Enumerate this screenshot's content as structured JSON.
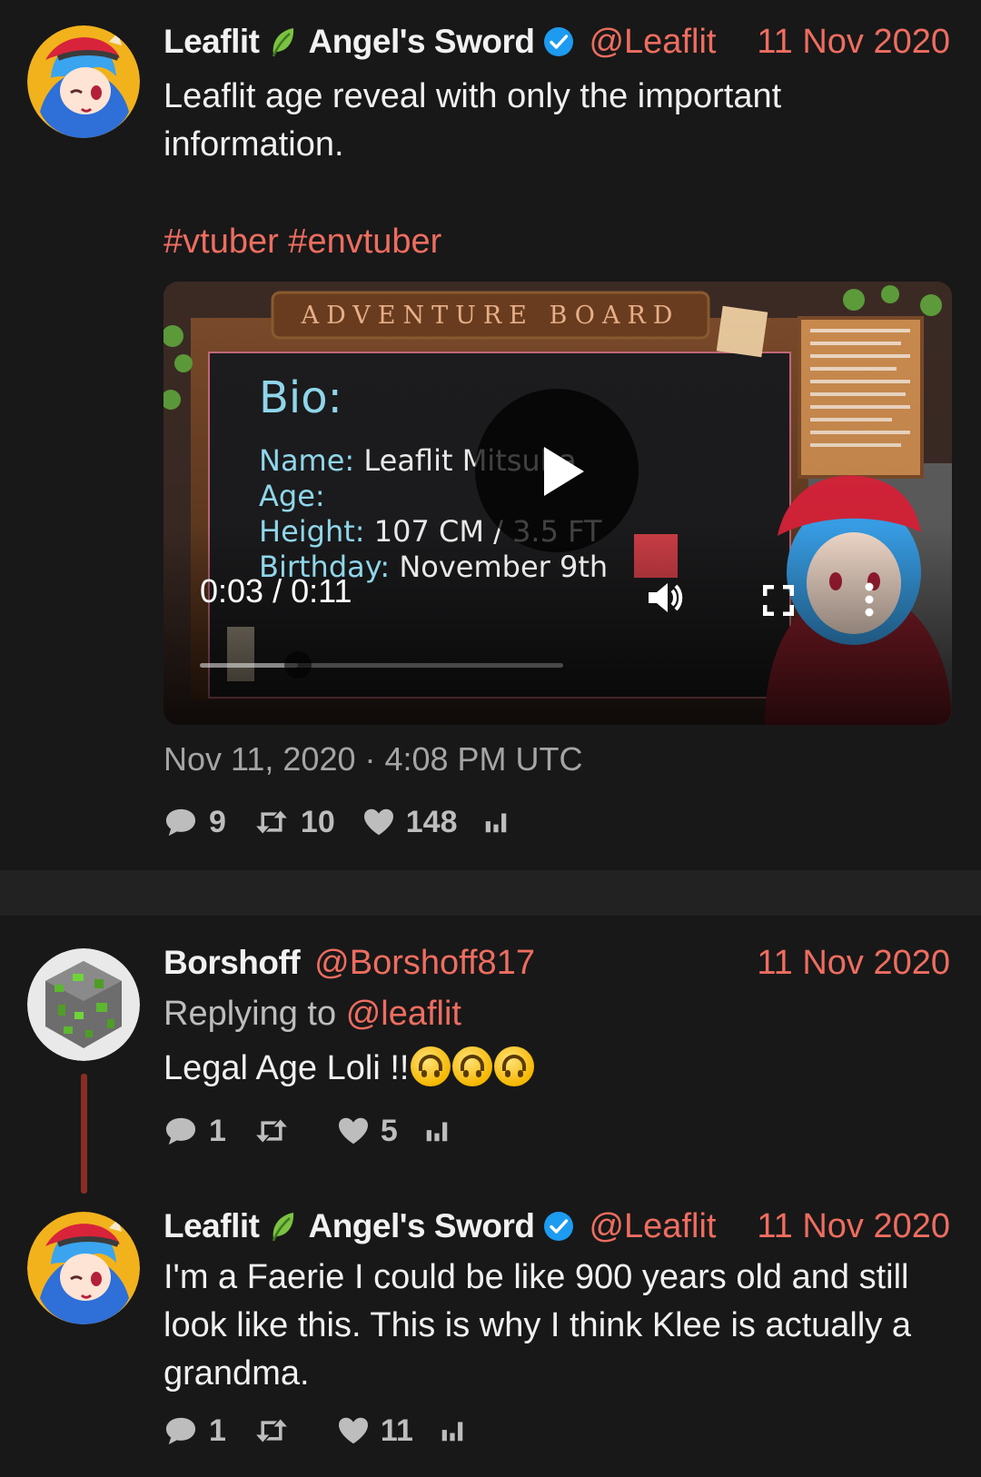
{
  "colors": {
    "background": "#181818",
    "accent": "#ee6d60",
    "text": "#f0f0f0",
    "muted": "#a5a5a5",
    "verified": "#1d9bf0",
    "thread_line": "#8a2d24"
  },
  "main_tweet": {
    "author": {
      "display_name": "Leaflit",
      "display_name_suffix": "Angel's Sword",
      "handle": "@Leaflit",
      "verified": true,
      "avatar_icon": "avatar-leaflit"
    },
    "date": "11 Nov 2020",
    "text": "Leaflit age reveal with only the important information.",
    "hashtags": "#vtuber #envtuber",
    "media": {
      "type": "video",
      "time": "0:03 / 0:11",
      "progress": 0.27,
      "poster": {
        "board_title": "ADVENTURE BOARD",
        "heading": "Bio:",
        "rows": [
          {
            "label": "Name:",
            "value": "Leaflit Mitsuba"
          },
          {
            "label": "Age:",
            "value": ""
          },
          {
            "label": "Height:",
            "value": "107 CM / 3.5 FT"
          },
          {
            "label": "Birthday:",
            "value": "November 9th"
          }
        ]
      },
      "controls": [
        "play-icon",
        "volume-icon",
        "fullscreen-icon",
        "more-vertical-icon"
      ]
    },
    "timestamp": "Nov 11, 2020 · 4:08 PM UTC",
    "stats": {
      "replies": "9",
      "retweets": "10",
      "likes": "148"
    }
  },
  "thread": [
    {
      "author": {
        "display_name": "Borshoff",
        "handle": "@Borshoff817",
        "avatar_icon": "avatar-borshoff"
      },
      "date": "11 Nov 2020",
      "replying_prefix": "Replying to",
      "replying_to": "@leaflit",
      "text": "Legal Age Loli !!",
      "emoji": "upside-down-face",
      "emoji_count": 3,
      "stats": {
        "replies": "1",
        "retweets": "",
        "likes": "5"
      }
    },
    {
      "author": {
        "display_name": "Leaflit",
        "display_name_suffix": "Angel's Sword",
        "handle": "@Leaflit",
        "verified": true,
        "avatar_icon": "avatar-leaflit"
      },
      "date": "11 Nov 2020",
      "text": "I'm a Faerie I could be like 900 years old and still look like this.  This is why I think Klee is actually a grandma.",
      "stats": {
        "replies": "1",
        "retweets": "",
        "likes": "11"
      }
    }
  ]
}
